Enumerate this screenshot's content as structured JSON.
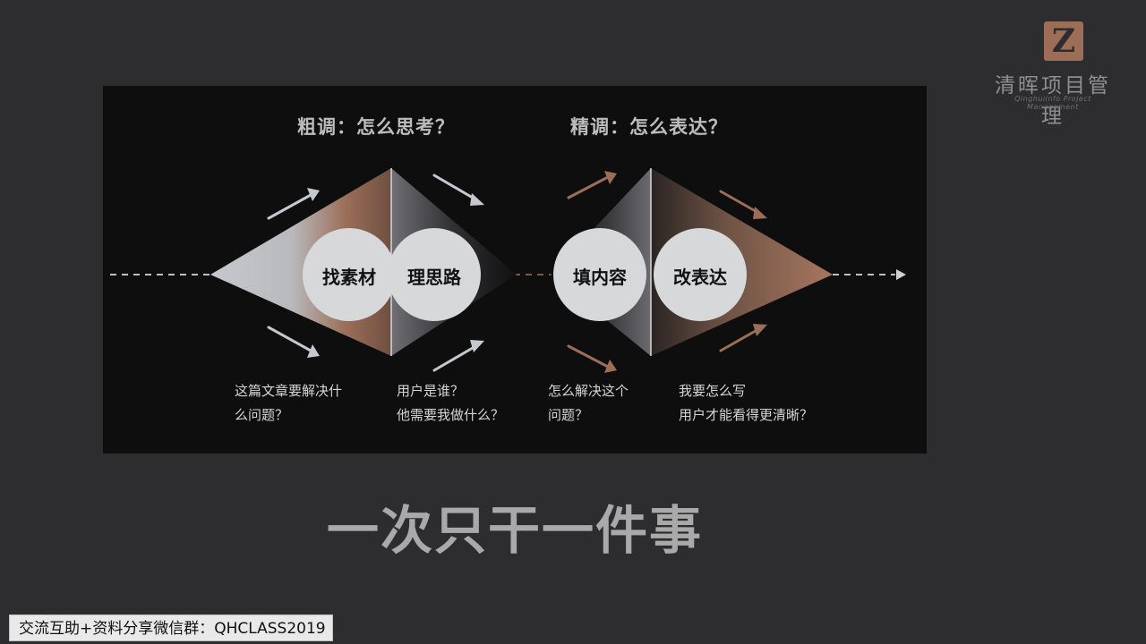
{
  "logo": {
    "mark": "Z",
    "name": "清晖项目管理",
    "name_en": "Qinghuiinfo Project Management"
  },
  "slide": {
    "phases": [
      {
        "title": "粗调：怎么思考？"
      },
      {
        "title": "精调：怎么表达？"
      }
    ],
    "steps": [
      {
        "label": "找素材",
        "note_lines": [
          "这篇文章要解决什",
          "么问题？"
        ]
      },
      {
        "label": "理思路",
        "note_lines": [
          "用户是谁？",
          "他需要我做什么？"
        ]
      },
      {
        "label": "填内容",
        "note_lines": [
          "怎么解决这个",
          "问题？"
        ]
      },
      {
        "label": "改表达",
        "note_lines": [
          "我要怎么写",
          "用户才能看得更清晰？"
        ]
      }
    ],
    "colors": {
      "grey": "#c4c9cf",
      "bronze": "#9b6e58",
      "dark": "#111111",
      "circle": "#d7d8da"
    }
  },
  "headline": "一次只干一件事",
  "group_banner": "交流互助+资料分享微信群：QHCLASS2019"
}
